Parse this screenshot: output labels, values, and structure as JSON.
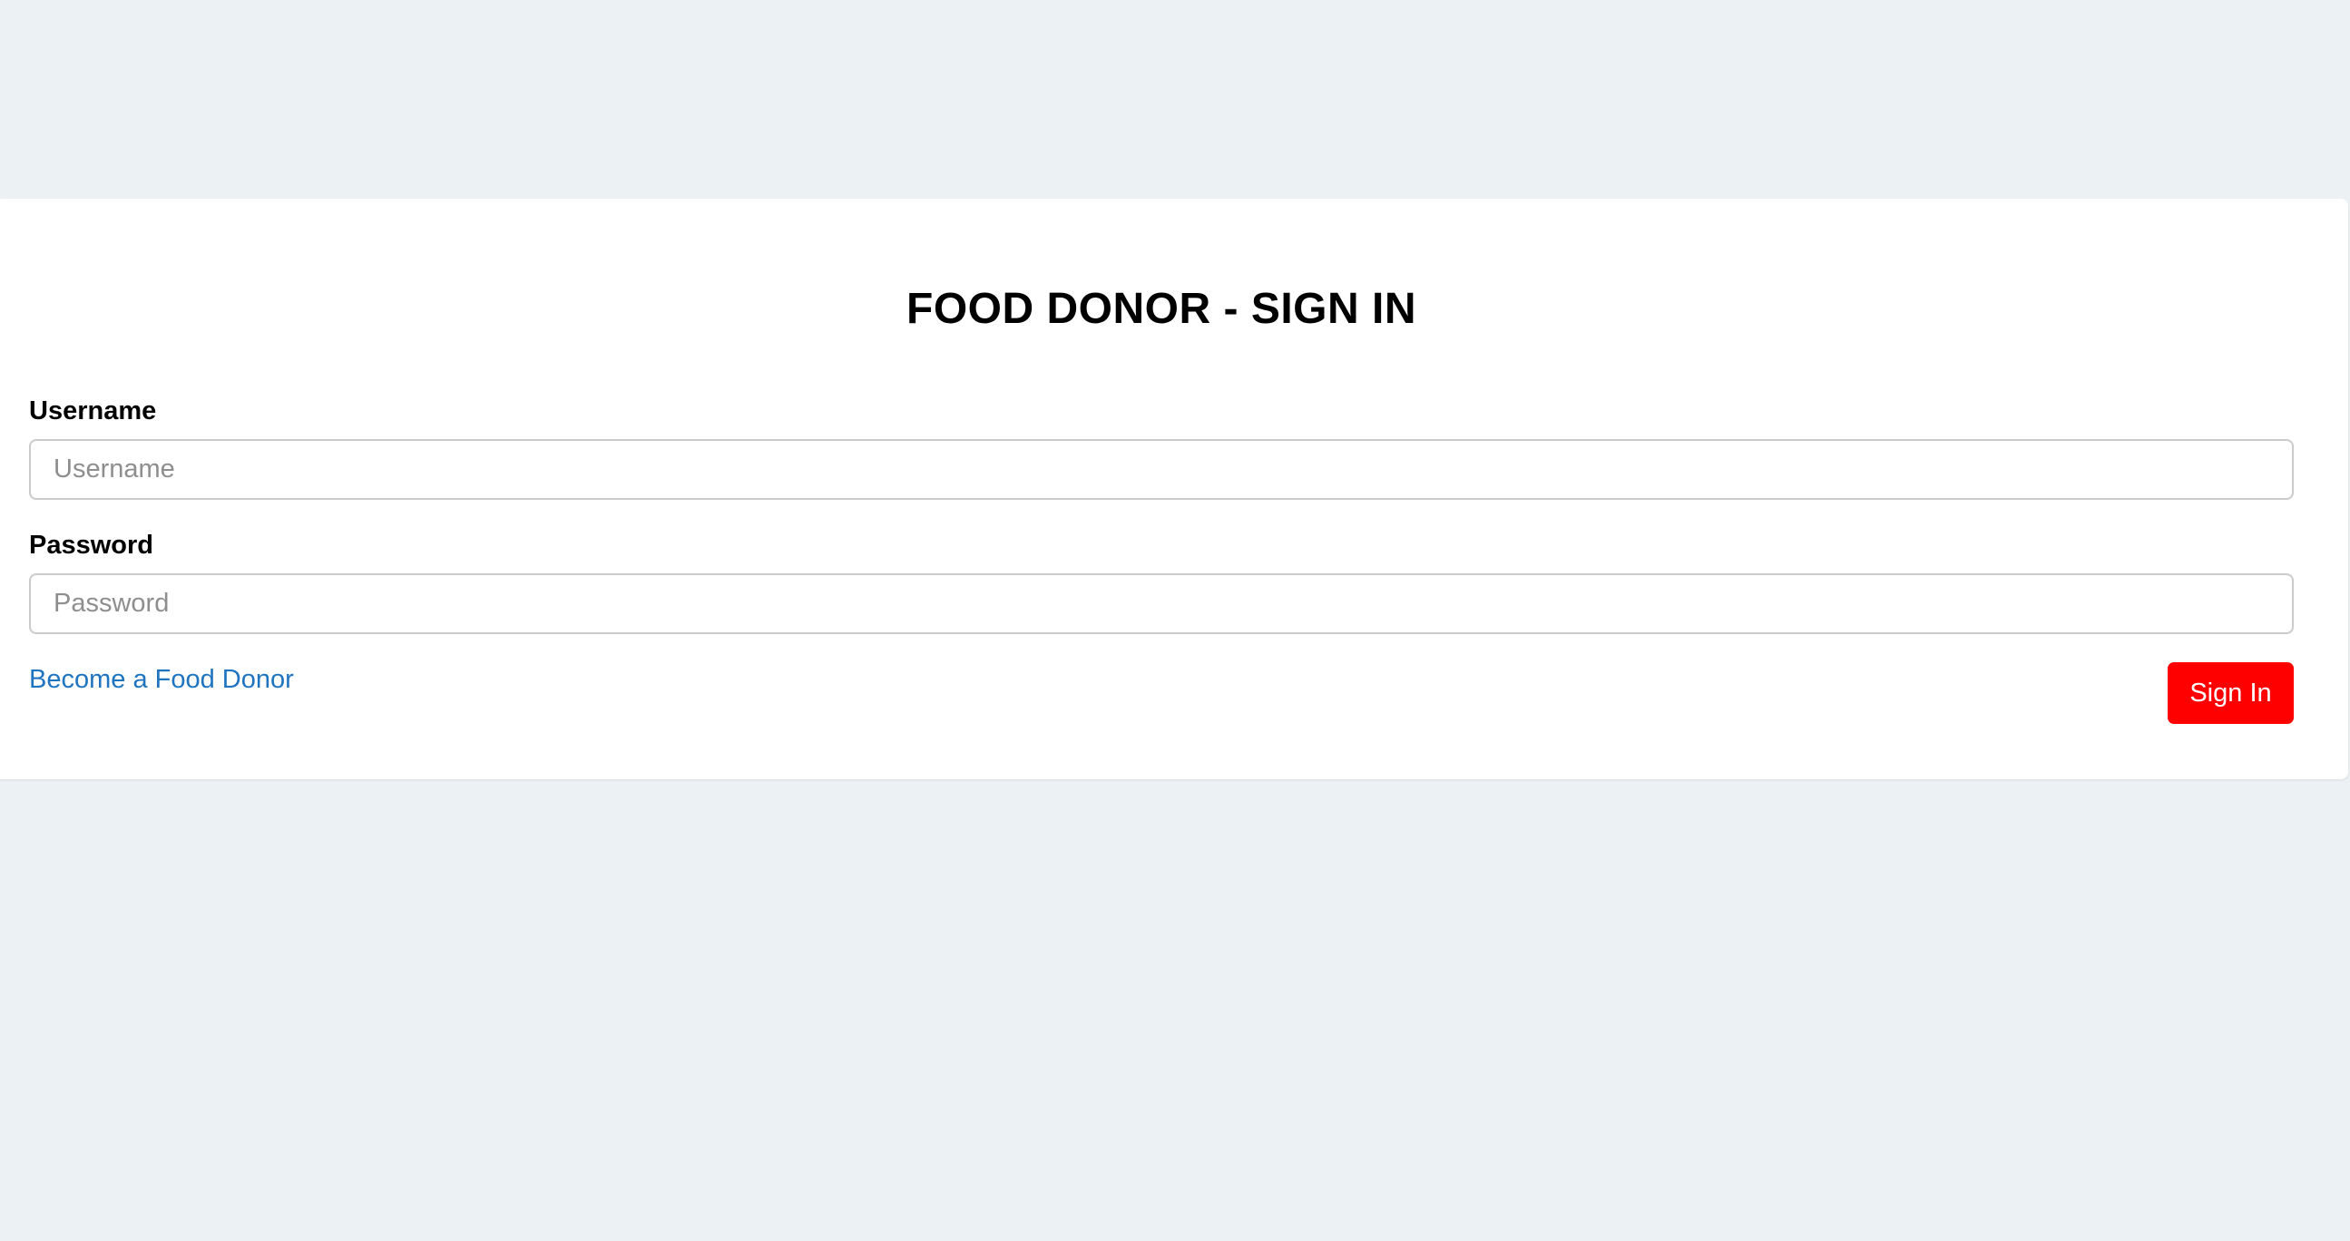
{
  "page": {
    "title": "FOOD DONOR - SIGN IN"
  },
  "form": {
    "username_label": "Username",
    "username_placeholder": "Username",
    "username_value": "",
    "password_label": "Password",
    "password_placeholder": "Password",
    "password_value": "",
    "register_link": "Become a Food Donor",
    "submit_label": "Sign In"
  },
  "colors": {
    "background": "#ecf1f4",
    "card": "#ffffff",
    "link": "#1f74c0",
    "submit_button": "#ff0000"
  }
}
